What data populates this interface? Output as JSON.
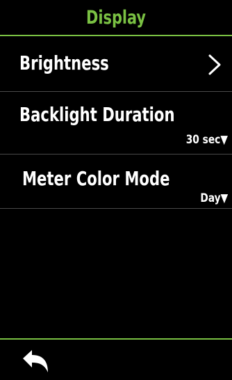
{
  "header": {
    "title": "Display"
  },
  "settings": [
    {
      "label": "Brightness",
      "icon": "chevron-right-icon"
    },
    {
      "label": "Backlight Duration",
      "value": "30 sec▼"
    },
    {
      "label": "Meter Color Mode",
      "value": "Day▼"
    }
  ],
  "footer": {
    "back_icon": "back-arrow-icon"
  },
  "colors": {
    "accent": "#7ac143",
    "background": "#000000",
    "text": "#ffffff",
    "divider": "#4a4a4a"
  }
}
